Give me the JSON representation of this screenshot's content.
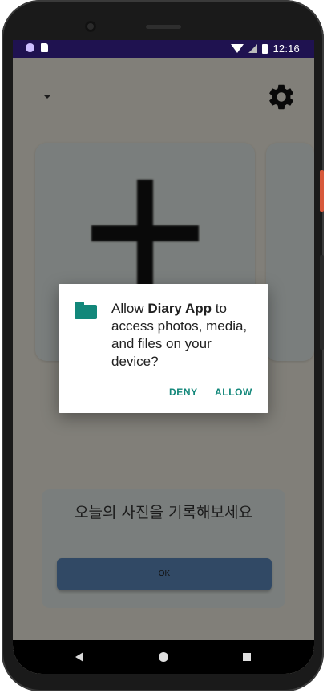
{
  "status_bar": {
    "time": "12:16",
    "icons": [
      "notification-dot-icon",
      "sd-card-icon",
      "wifi-icon",
      "signal-icon",
      "battery-icon"
    ]
  },
  "app": {
    "dropdown_icon": "dropdown-arrow-icon",
    "settings_icon": "gear-icon",
    "add_card_icon": "plus-icon",
    "prompt_text": "오늘의 사진을 기록해보세요",
    "ok_label": "OK"
  },
  "dialog": {
    "icon": "folder-icon",
    "message_prefix": "Allow ",
    "app_name": "Diary App",
    "message_suffix": " to access photos, media, and files on your device?",
    "deny_label": "DENY",
    "allow_label": "ALLOW"
  },
  "navigation": {
    "back_icon": "back-icon",
    "home_icon": "home-icon",
    "recents_icon": "recents-icon"
  },
  "colors": {
    "status_bar": "#1f1250",
    "accent": "#12877a",
    "ok_button": "#5a86b8"
  }
}
